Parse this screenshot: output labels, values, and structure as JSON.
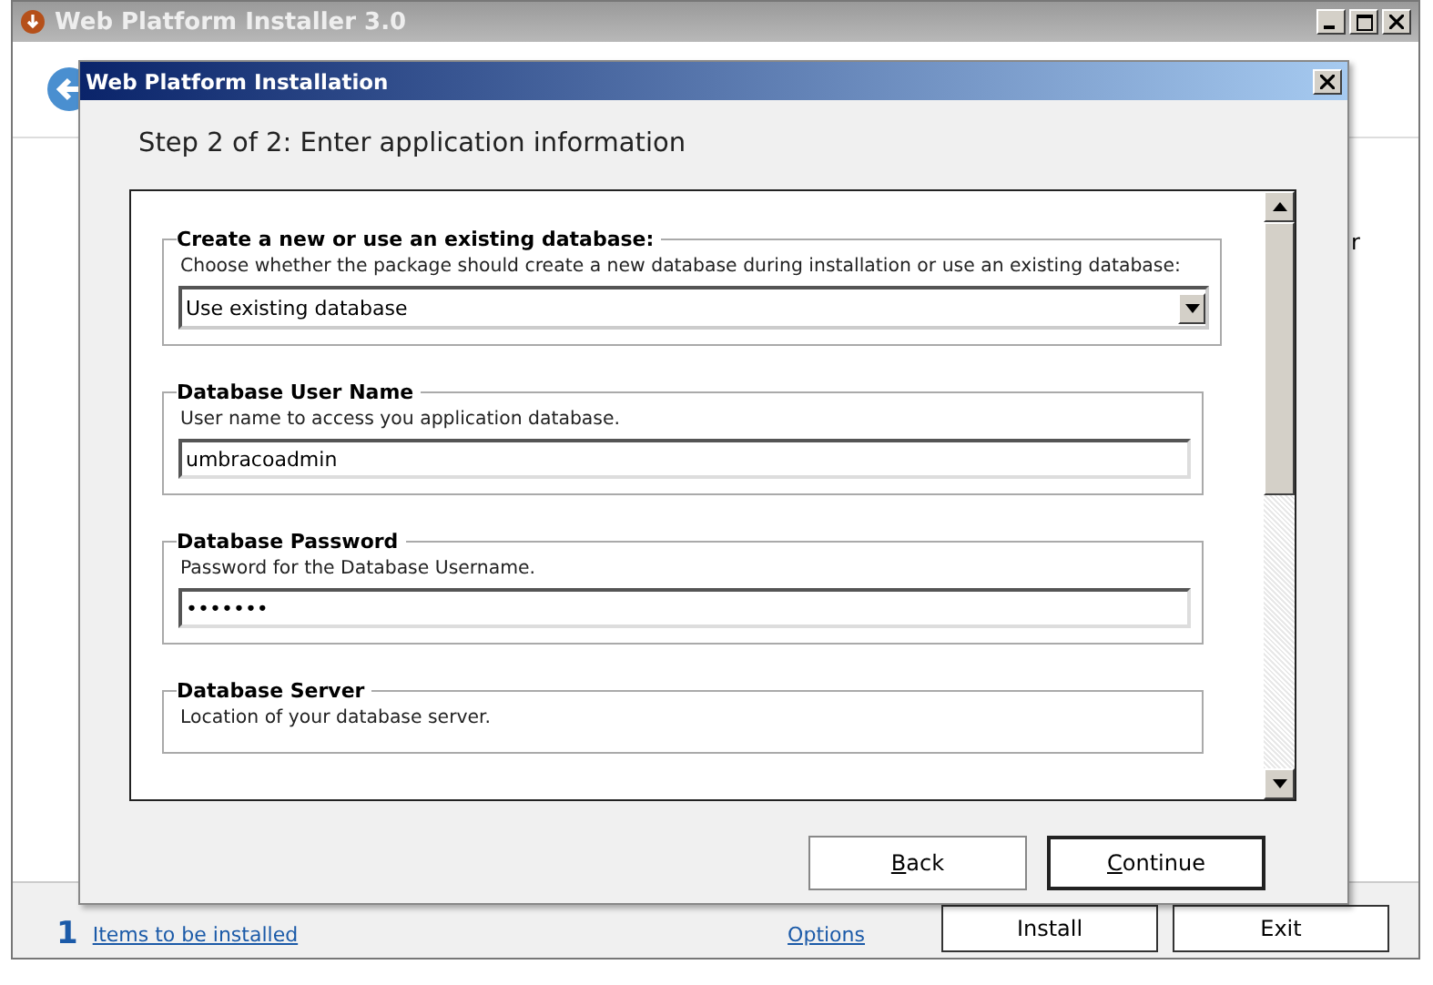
{
  "main_window": {
    "title": "Web Platform Installer 3.0",
    "side_text": "r",
    "footer": {
      "count": "1",
      "items_link": "Items to be installed",
      "options_link": "Options",
      "buttons": [
        "Install",
        "Exit"
      ]
    }
  },
  "dialog": {
    "title": "Web Platform Installation",
    "step": "Step 2 of 2: Enter application information",
    "groups": [
      {
        "kind": "dropdown",
        "title": "Create a new or use an existing database:",
        "description": "Choose whether the package should create a new database during installation or use an existing database:",
        "value": "Use existing database"
      },
      {
        "kind": "text",
        "title": "Database User Name",
        "description": "User name to access you application database.",
        "value": "umbracoadmin"
      },
      {
        "kind": "password",
        "title": "Database Password",
        "description": "Password for the Database Username.",
        "value": "•••••••"
      },
      {
        "kind": "text",
        "title": "Database Server",
        "description": "Location of your database server."
      }
    ],
    "buttons": [
      "Back",
      "Continue"
    ]
  }
}
